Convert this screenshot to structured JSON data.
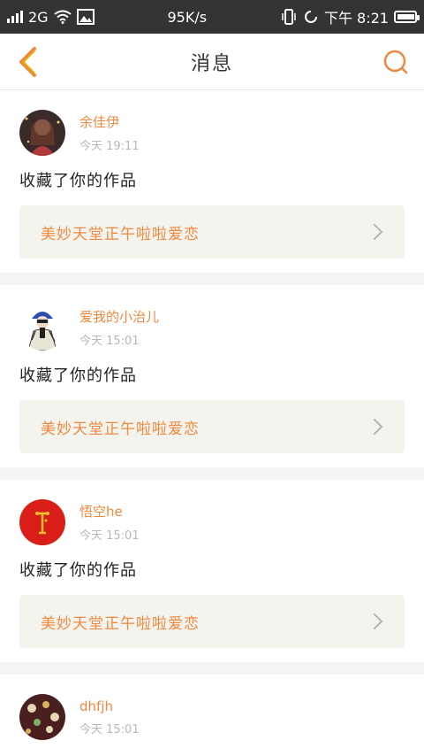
{
  "status_bar": {
    "network": "2G",
    "speed": "95K/s",
    "time": "下午 8:21"
  },
  "header": {
    "title": "消息"
  },
  "colors": {
    "accent": "#f0883e",
    "link_bg": "#f4f4ee",
    "separator": "#f4f4f4"
  },
  "messages": [
    {
      "username": "余佳伊",
      "time": "今天 19:11",
      "action": "收藏了你的作品",
      "work_title": "美妙天堂正午啦啦爱恋"
    },
    {
      "username": "爱我的小治儿",
      "time": "今天 15:01",
      "action": "收藏了你的作品",
      "work_title": "美妙天堂正午啦啦爱恋"
    },
    {
      "username": "悟空he",
      "time": "今天 15:01",
      "action": "收藏了你的作品",
      "work_title": "美妙天堂正午啦啦爱恋"
    },
    {
      "username": "dhfjh",
      "time": "今天 15:01",
      "action": "",
      "work_title": ""
    }
  ]
}
